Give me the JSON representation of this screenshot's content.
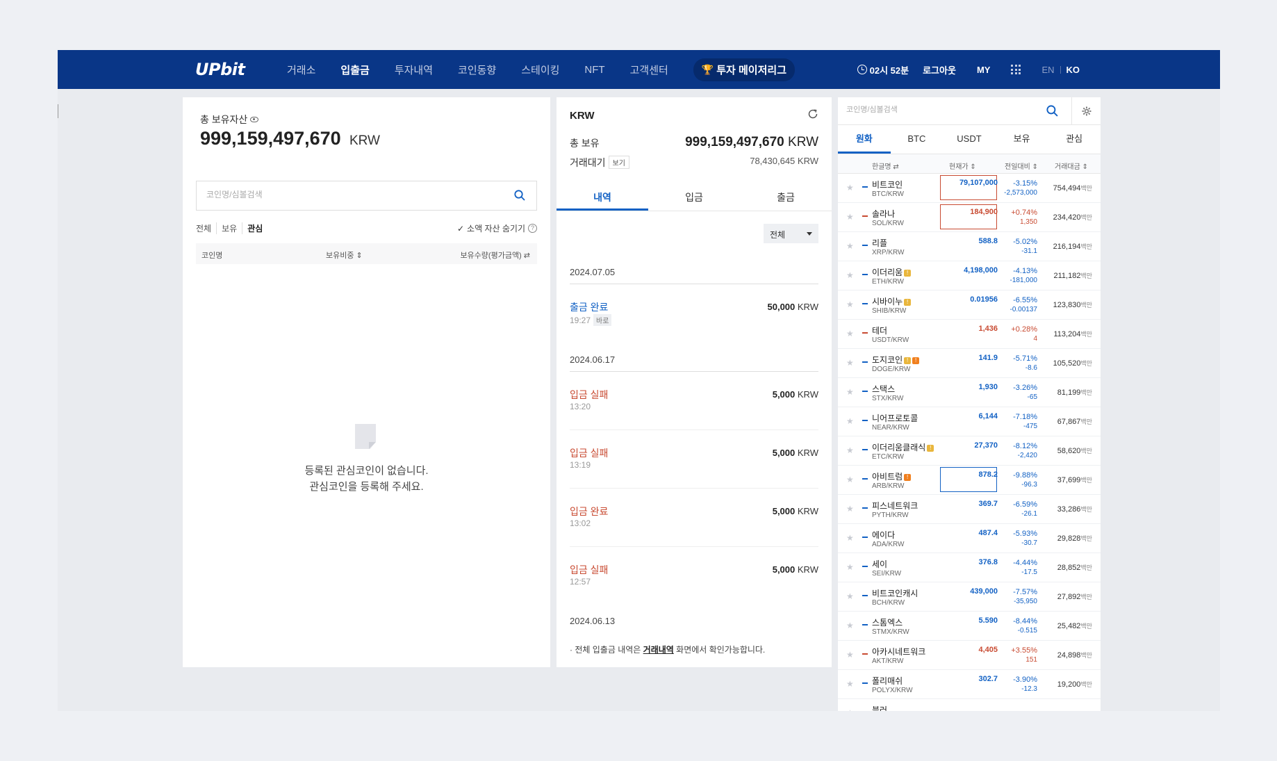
{
  "header": {
    "logo": "UPbit",
    "nav": [
      "거래소",
      "입출금",
      "투자내역",
      "코인동향",
      "스테이킹",
      "NFT",
      "고객센터"
    ],
    "active_nav": "입출금",
    "league": "투자 메이저리그",
    "timer": "02시 52분",
    "logout": "로그아웃",
    "my": "MY",
    "lang_en": "EN",
    "lang_ko": "KO"
  },
  "assets": {
    "title": "총 보유자산",
    "amount": "999,159,497,670",
    "unit": "KRW",
    "search_placeholder": "코인명/심볼검색",
    "filters": [
      "전체",
      "보유",
      "관심"
    ],
    "active_filter": "관심",
    "hide_small": "소액 자산 숨기기",
    "columns": {
      "name": "코인명",
      "ratio": "보유비중 ⇕",
      "qty": "보유수량(평가금액) ⇄"
    },
    "empty_line1": "등록된 관심코인이 없습니다.",
    "empty_line2": "관심코인을 등록해 주세요."
  },
  "krw": {
    "title": "KRW",
    "total_label": "총 보유",
    "total_value": "999,159,497,670",
    "total_unit": "KRW",
    "pending_label": "거래대기",
    "pending_badge": "보기",
    "pending_value": "78,430,645 KRW",
    "tabs": [
      "내역",
      "입금",
      "출금"
    ],
    "filter_value": "전체",
    "dates": [
      "2024.07.05",
      "2024.06.17",
      "2024.06.13"
    ],
    "transactions": [
      {
        "status": "출금 완료",
        "time": "19:27",
        "tag": "바로",
        "amount": "50,000",
        "unit": "KRW"
      },
      {
        "status": "입금 실패",
        "time": "13:20",
        "amount": "5,000",
        "unit": "KRW"
      },
      {
        "status": "입금 실패",
        "time": "13:19",
        "amount": "5,000",
        "unit": "KRW"
      },
      {
        "status": "입금 완료",
        "time": "13:02",
        "amount": "5,000",
        "unit": "KRW"
      },
      {
        "status": "입금 실패",
        "time": "12:57",
        "amount": "5,000",
        "unit": "KRW"
      }
    ],
    "note_prefix": "·  전체 입출금 내역은 ",
    "note_link": "거래내역",
    "note_suffix": " 화면에서 확인가능합니다."
  },
  "market": {
    "search_placeholder": "코인명/심볼검색",
    "tabs": [
      "원화",
      "BTC",
      "USDT",
      "보유",
      "관심"
    ],
    "active_tab": "원화",
    "columns": {
      "name": "한글명 ⇄",
      "price": "현재가 ⇕",
      "change": "전일대비 ⇕",
      "volume": "거래대금 ⇕"
    },
    "volume_unit": "백만",
    "coins": [
      {
        "name": "비트코인",
        "pair": "BTC/KRW",
        "price": "79,107,000",
        "pct": "-3.15%",
        "amt": "-2,573,000",
        "vol": "754,494",
        "dir": "down",
        "box": "red"
      },
      {
        "name": "솔라나",
        "pair": "SOL/KRW",
        "price": "184,900",
        "pct": "+0.74%",
        "amt": "1,350",
        "vol": "234,420",
        "dir": "up",
        "box": "red"
      },
      {
        "name": "리플",
        "pair": "XRP/KRW",
        "price": "588.8",
        "pct": "-5.02%",
        "amt": "-31.1",
        "vol": "216,194",
        "dir": "down"
      },
      {
        "name": "이더리움",
        "pair": "ETH/KRW",
        "price": "4,198,000",
        "pct": "-4.13%",
        "amt": "-181,000",
        "vol": "211,182",
        "dir": "down",
        "warn": [
          "y"
        ]
      },
      {
        "name": "시바이누",
        "pair": "SHIB/KRW",
        "price": "0.01956",
        "pct": "-6.55%",
        "amt": "-0.00137",
        "vol": "123,830",
        "dir": "down",
        "warn": [
          "y"
        ]
      },
      {
        "name": "테더",
        "pair": "USDT/KRW",
        "price": "1,436",
        "pct": "+0.28%",
        "amt": "4",
        "vol": "113,204",
        "dir": "up"
      },
      {
        "name": "도지코인",
        "pair": "DOGE/KRW",
        "price": "141.9",
        "pct": "-5.71%",
        "amt": "-8.6",
        "vol": "105,520",
        "dir": "down",
        "warn": [
          "y",
          "o"
        ]
      },
      {
        "name": "스택스",
        "pair": "STX/KRW",
        "price": "1,930",
        "pct": "-3.26%",
        "amt": "-65",
        "vol": "81,199",
        "dir": "down"
      },
      {
        "name": "니어프로토콜",
        "pair": "NEAR/KRW",
        "price": "6,144",
        "pct": "-7.18%",
        "amt": "-475",
        "vol": "67,867",
        "dir": "down"
      },
      {
        "name": "이더리움클래식",
        "pair": "ETC/KRW",
        "price": "27,370",
        "pct": "-8.12%",
        "amt": "-2,420",
        "vol": "58,620",
        "dir": "down",
        "warn": [
          "y"
        ]
      },
      {
        "name": "아비트럼",
        "pair": "ARB/KRW",
        "price": "878.2",
        "pct": "-9.88%",
        "amt": "-96.3",
        "vol": "37,699",
        "dir": "down",
        "warn": [
          "o"
        ],
        "box": "blue"
      },
      {
        "name": "피스네트워크",
        "pair": "PYTH/KRW",
        "price": "369.7",
        "pct": "-6.59%",
        "amt": "-26.1",
        "vol": "33,286",
        "dir": "down"
      },
      {
        "name": "에이다",
        "pair": "ADA/KRW",
        "price": "487.4",
        "pct": "-5.93%",
        "amt": "-30.7",
        "vol": "29,828",
        "dir": "down"
      },
      {
        "name": "세이",
        "pair": "SEI/KRW",
        "price": "376.8",
        "pct": "-4.44%",
        "amt": "-17.5",
        "vol": "28,852",
        "dir": "down"
      },
      {
        "name": "비트코인캐시",
        "pair": "BCH/KRW",
        "price": "439,000",
        "pct": "-7.57%",
        "amt": "-35,950",
        "vol": "27,892",
        "dir": "down"
      },
      {
        "name": "스톰엑스",
        "pair": "STMX/KRW",
        "price": "5.590",
        "pct": "-8.44%",
        "amt": "-0.515",
        "vol": "25,482",
        "dir": "down"
      },
      {
        "name": "아카시네트워크",
        "pair": "AKT/KRW",
        "price": "4,405",
        "pct": "+3.55%",
        "amt": "151",
        "vol": "24,898",
        "dir": "up"
      },
      {
        "name": "폴리매쉬",
        "pair": "POLYX/KRW",
        "price": "302.7",
        "pct": "-3.90%",
        "amt": "-12.3",
        "vol": "19,200",
        "dir": "down"
      },
      {
        "name": "블러",
        "pair": "",
        "price": "",
        "pct": "",
        "amt": "",
        "vol": "",
        "dir": "down"
      }
    ]
  },
  "colors": {
    "header": "#093687",
    "up": "#c84a31",
    "down": "#1261c4"
  }
}
